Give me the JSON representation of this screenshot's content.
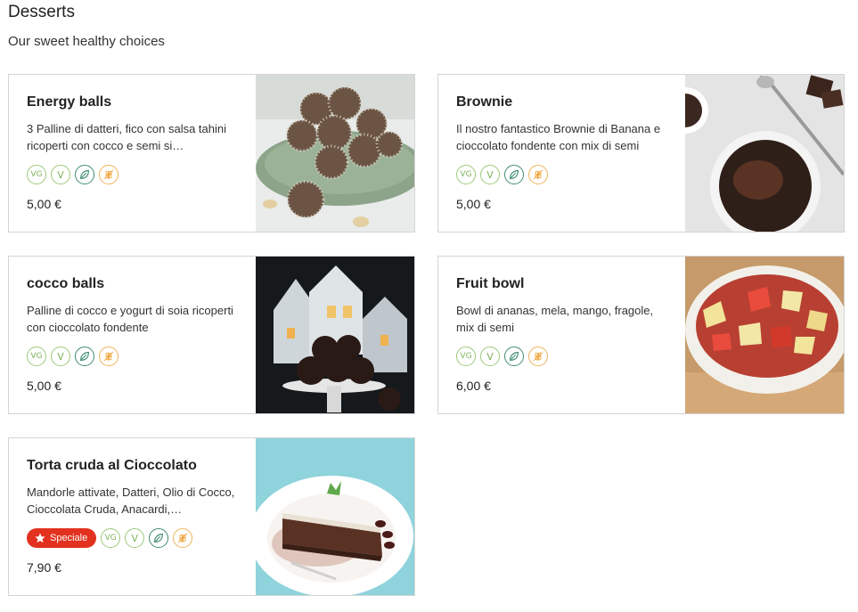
{
  "section": {
    "title": "Desserts",
    "subtitle": "Our sweet healthy choices"
  },
  "icons": {
    "vegan": "vegan-icon",
    "vegetarian": "vegetarian-icon",
    "plant_based": "leaf-icon",
    "gluten_free": "gluten-free-wheat-icon",
    "star": "star-icon"
  },
  "badges": {
    "vegan": "VG",
    "vegetarian": "V"
  },
  "colors": {
    "special_badge": "#e2321f",
    "vegan_badge": "#9dc97a",
    "leaf_badge": "#3e8b72",
    "gluten_badge": "#f0b35a",
    "card_border": "#d4d4d4"
  },
  "items": [
    {
      "name": "Energy balls",
      "description": "3 Palline di datteri, fico con salsa tahini ricoperti con cocco e semi si…",
      "price": "5,00 €"
    },
    {
      "name": "Brownie",
      "description": "Il nostro fantastico Brownie di Banana e cioccolato fondente con mix di semi",
      "price": "5,00 €"
    },
    {
      "name": "cocco balls",
      "description": "Palline di cocco e yogurt di soia ricoperti con cioccolato fondente",
      "price": "5,00 €"
    },
    {
      "name": "Fruit bowl",
      "description": "Bowl di ananas, mela, mango, fragole, mix di semi",
      "price": "6,00 €"
    },
    {
      "name": "Torta cruda al Cioccolato",
      "description": "Mandorle attivate, Datteri, Olio di Cocco, Cioccolata Cruda, Anacardi,…",
      "price": "7,90 €",
      "special_label": "Speciale"
    }
  ]
}
